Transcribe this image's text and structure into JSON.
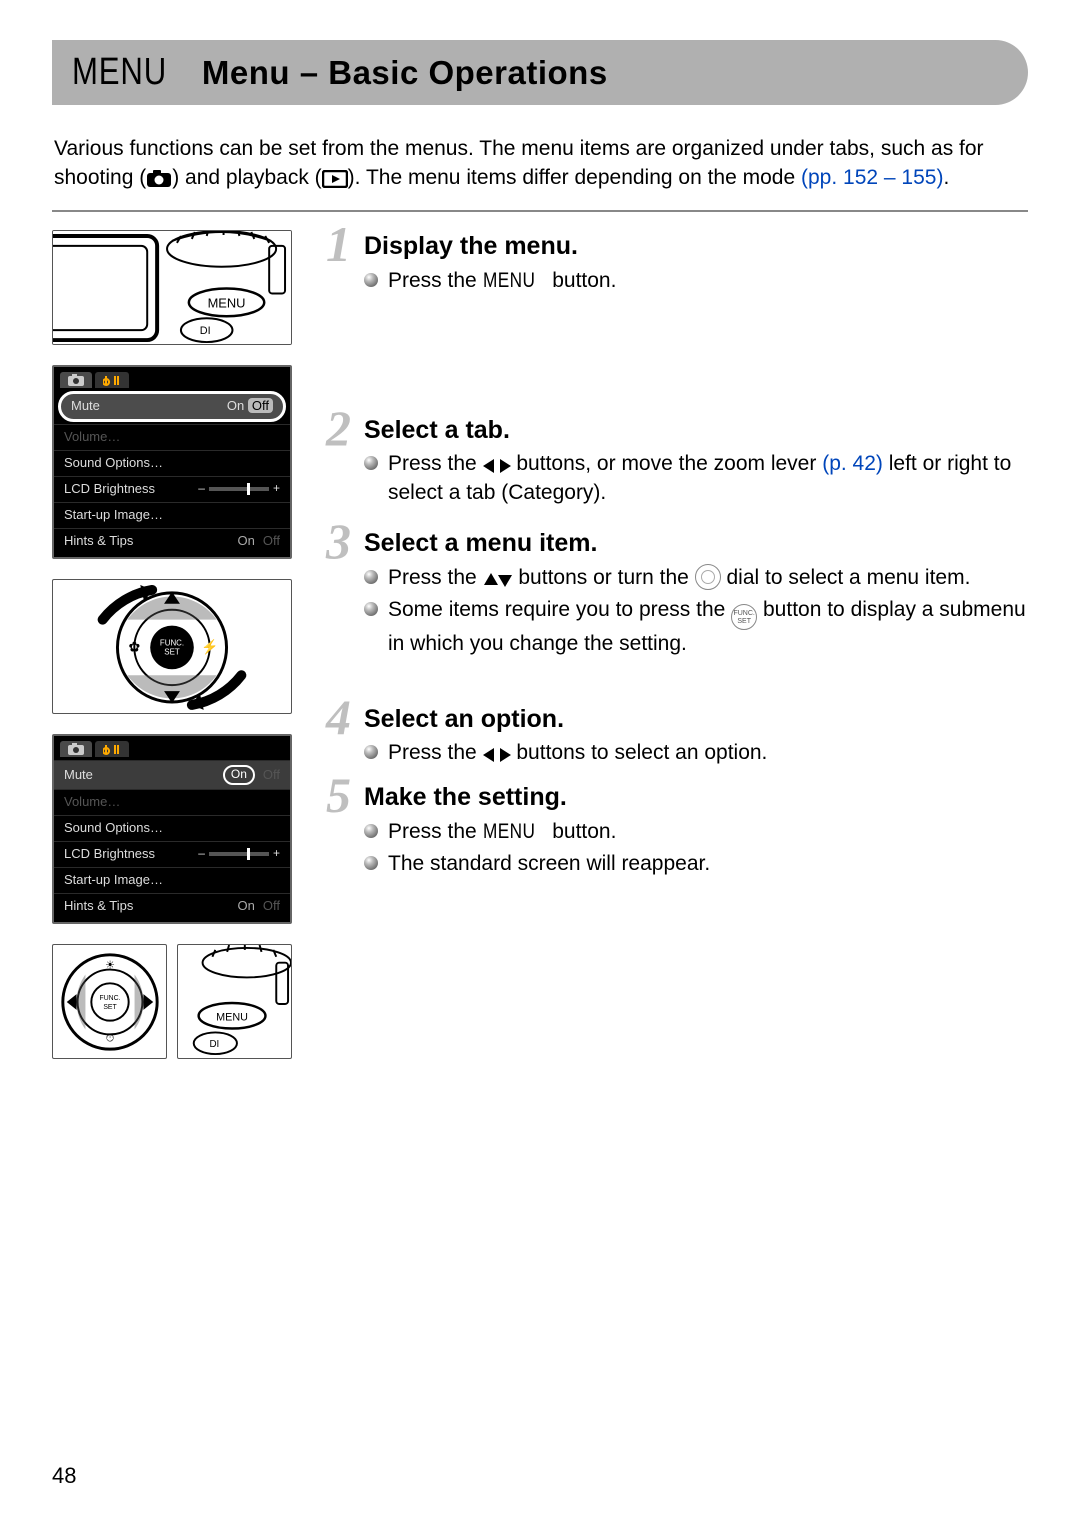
{
  "title": {
    "menu_word": "MENU",
    "text": "Menu – Basic Operations"
  },
  "intro": {
    "before_icons": "Various functions can be set from the menus. The menu items are organized under tabs, such as for shooting (",
    "between_icons": ") and playback (",
    "after_icons": "). The menu items differ depending on the mode ",
    "page_ref_open": "(pp. 152",
    "page_ref_dash": " – ",
    "page_ref_close": "155)",
    "period": "."
  },
  "steps": [
    {
      "num": "1",
      "heading": "Display the menu.",
      "bullets": [
        {
          "pre": "Press the ",
          "menu_word": "MENU",
          "post": " button."
        }
      ]
    },
    {
      "num": "2",
      "heading": "Select a tab.",
      "bullets": [
        {
          "pre": "Press the ",
          "leftright": true,
          "mid": " buttons, or move the zoom lever ",
          "page_ref": "(p. 42)",
          "post": " left or right to select a tab (Category)."
        }
      ]
    },
    {
      "num": "3",
      "heading": "Select a menu item.",
      "bullets": [
        {
          "pre": "Press the ",
          "updown": true,
          "mid": " buttons or turn the ",
          "dial": true,
          "post": " dial to select a menu item."
        },
        {
          "pre": "Some items require you to press the ",
          "func": true,
          "post": " button to display a submenu in which you change the setting."
        }
      ]
    },
    {
      "num": "4",
      "heading": "Select an option.",
      "bullets": [
        {
          "pre": "Press the ",
          "leftright": true,
          "post": " buttons to select an option."
        }
      ]
    },
    {
      "num": "5",
      "heading": "Make the setting.",
      "bullets": [
        {
          "pre": "Press the ",
          "menu_word": "MENU",
          "post": " button."
        },
        {
          "pre": "The standard screen will reappear."
        }
      ]
    }
  ],
  "lcd_menu": {
    "tabs": [
      "camera",
      "tools"
    ],
    "rows": [
      {
        "label": "Mute",
        "on": "On",
        "off": "Off"
      },
      {
        "label": "Volume…"
      },
      {
        "label": "Sound Options…"
      },
      {
        "label": "LCD Brightness",
        "type": "slider"
      },
      {
        "label": "Start-up Image…"
      },
      {
        "label": "Hints & Tips",
        "on": "On",
        "off": "Off"
      }
    ]
  },
  "page_number": "48",
  "icons": {
    "func_label1": "FUNC.",
    "func_label2": "SET"
  }
}
